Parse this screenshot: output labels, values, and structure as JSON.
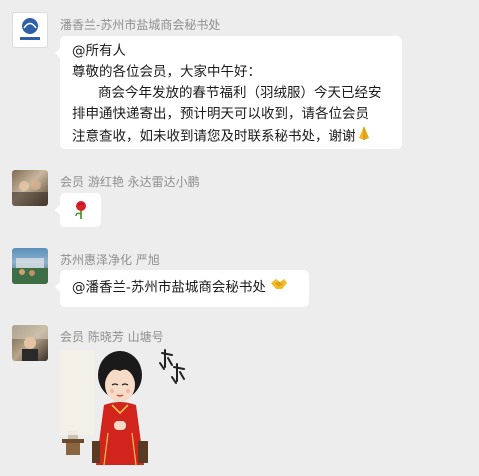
{
  "messages": [
    {
      "sender": "潘香兰-苏州市盐城商会秘书处",
      "lines": [
        "@所有人",
        "尊敬的各位会员，大家中午好：",
        "商会今年发放的春节福利（羽绒服）今天已经安",
        "排申通快递寄出，预计明天可以收到，请各位会员",
        "注意查收，如未收到请您及时联系秘书处，谢谢"
      ],
      "emoji": "pray"
    },
    {
      "sender": "会员  游红艳 永达雷达小鹏",
      "emoji": "rose"
    },
    {
      "sender": "苏州惠泽净化  严旭",
      "text": "@潘香兰-苏州市盐城商会秘书处",
      "emoji": "handshake"
    },
    {
      "sender": "会员 陈晓芳 山塘号",
      "sticker_text": "谢谢"
    }
  ]
}
